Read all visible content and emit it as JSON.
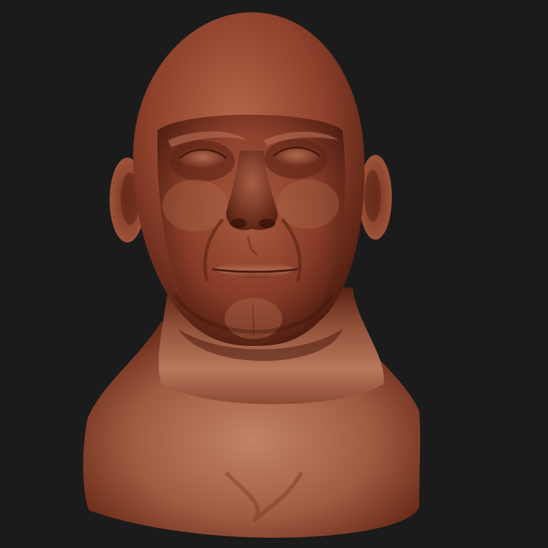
{
  "scene": {
    "background_color": "#1b1b1b",
    "model": {
      "subject": "sculpted-head-bust",
      "material_color": "#8a3f2a",
      "highlight_color": "#c27a5c",
      "shadow_color": "#3a130a"
    }
  }
}
